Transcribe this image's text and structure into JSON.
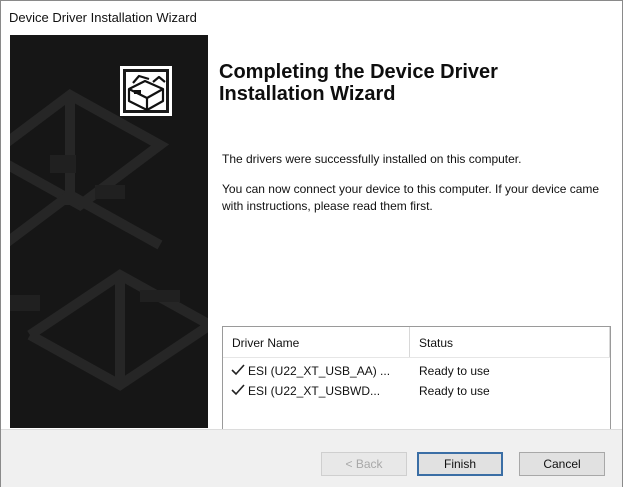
{
  "window": {
    "title": "Device Driver Installation Wizard"
  },
  "sidebar": {
    "logo_icon": "wizard-box-icon"
  },
  "main": {
    "heading": "Completing the Device Driver Installation Wizard",
    "success_text": "The drivers were successfully installed on this computer.",
    "info_text": "You can now connect your device to this computer. If your device came with instructions, please read them first."
  },
  "driver_table": {
    "columns": [
      "Driver Name",
      "Status"
    ],
    "rows": [
      {
        "icon": "checkmark-icon",
        "name": "ESI (U22_XT_USB_AA) ...",
        "status": "Ready to use"
      },
      {
        "icon": "checkmark-icon",
        "name": "ESI (U22_XT_USBWD...",
        "status": "Ready to use"
      }
    ]
  },
  "buttons": {
    "back": "< Back",
    "finish": "Finish",
    "cancel": "Cancel"
  }
}
